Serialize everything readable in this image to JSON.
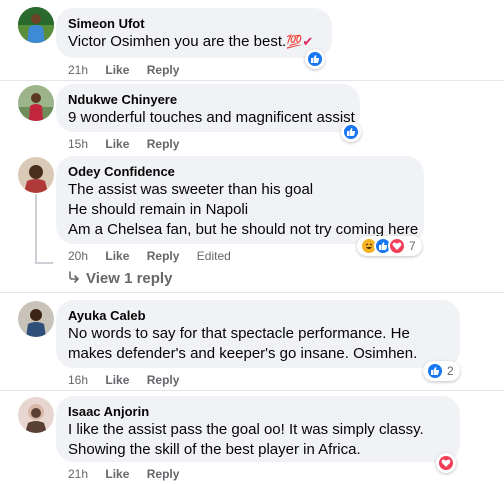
{
  "comments": [
    {
      "name": "Simeon Ufot",
      "text_lines": [
        "Victor Osimhen you are the best."
      ],
      "emoji": "💯✔",
      "time": "21h",
      "like": "Like",
      "reply": "Reply",
      "reactions": {
        "icons": [
          "like-icon"
        ],
        "count": ""
      },
      "avatar_colors": {
        "bg": "#2a6a2f",
        "shirt": "#3d8bd6"
      }
    },
    {
      "name": "Ndukwe Chinyere",
      "text_lines": [
        "9 wonderful touches and magnificent assist"
      ],
      "time": "15h",
      "like": "Like",
      "reply": "Reply",
      "reactions": {
        "icons": [
          "like-icon"
        ],
        "count": ""
      },
      "avatar_colors": {
        "bg": "#6d8d5a",
        "shirt": "#c2263c"
      }
    },
    {
      "name": "Odey Confidence",
      "text_lines": [
        "The assist was sweeter than his goal",
        "He should remain in Napoli",
        "Am a Chelsea fan, but he should not try coming here"
      ],
      "time": "20h",
      "like": "Like",
      "reply": "Reply",
      "edited": "Edited",
      "reactions": {
        "icons": [
          "haha-icon",
          "like-icon",
          "love-icon"
        ],
        "count": "7"
      },
      "view_replies": "View 1 reply",
      "avatar_colors": {
        "bg": "#d9c9b6",
        "shirt": "#b03a3a"
      }
    },
    {
      "name": "Ayuka Caleb",
      "text_lines": [
        "No words to say for that spectacle performance. He",
        "makes defender's and keeper's go insane. Osimhen."
      ],
      "time": "16h",
      "like": "Like",
      "reply": "Reply",
      "reactions": {
        "icons": [
          "like-icon"
        ],
        "count": "2"
      },
      "avatar_colors": {
        "bg": "#c9c2b8",
        "shirt": "#2f4f7a"
      }
    },
    {
      "name": "Isaac Anjorin",
      "text_lines": [
        "I like the assist pass the goal oo! It was simply classy.",
        "Showing the skill of the best player in Africa."
      ],
      "time": "21h",
      "like": "Like",
      "reply": "Reply",
      "reactions": {
        "icons": [
          "love-icon"
        ],
        "count": ""
      },
      "avatar_colors": {
        "bg": "#e8d6d0",
        "shirt": "#5a4033"
      }
    }
  ],
  "colors": {
    "like_blue": "#1877f2",
    "love_red": "#f33e58",
    "haha_yellow": "#f7b125",
    "bubble_bg": "#f0f2f5",
    "meta_gray": "#65676b"
  }
}
